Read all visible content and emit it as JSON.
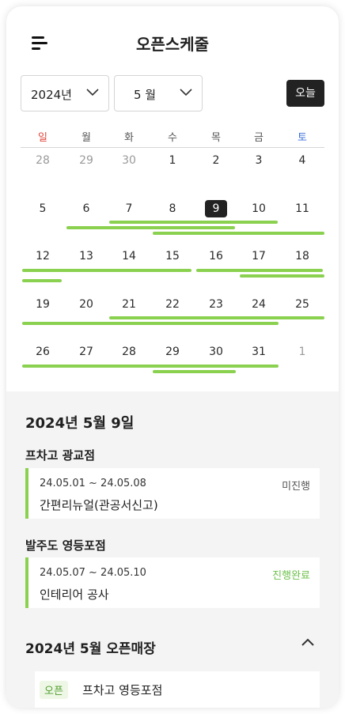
{
  "header": {
    "title": "오픈스케줄",
    "menu_icon": "menu-icon"
  },
  "controls": {
    "year": "2024년",
    "month": "5 월",
    "today_label": "오늘"
  },
  "weekdays": [
    "일",
    "월",
    "화",
    "수",
    "목",
    "금",
    "토"
  ],
  "weekday_colors": {
    "sun": "#e0463c",
    "sat": "#3b6fd8",
    "normal": "#555555"
  },
  "calendar": {
    "weeks": [
      [
        "28",
        "29",
        "30",
        "1",
        "2",
        "3",
        "4"
      ],
      [
        "5",
        "6",
        "7",
        "8",
        "9",
        "10",
        "11"
      ],
      [
        "12",
        "13",
        "14",
        "15",
        "16",
        "17",
        "18"
      ],
      [
        "19",
        "20",
        "21",
        "22",
        "23",
        "24",
        "25"
      ],
      [
        "26",
        "27",
        "28",
        "29",
        "30",
        "31",
        "1"
      ]
    ],
    "selected_day": "9",
    "schedule_bar_color": "#8ad14f"
  },
  "detail": {
    "date_title": "2024년 5월 9일",
    "stores": [
      {
        "name": "프차고 광교점",
        "range": "24.05.01 ~ 24.05.08",
        "task": "간편리뉴얼(관공서신고)",
        "status": "미진행",
        "status_color": "#555555"
      },
      {
        "name": "발주도 영등포점",
        "range": "24.05.07 ~ 24.05.10",
        "task": "인테리어 공사",
        "status": "진행완료",
        "status_color": "#6cc04a"
      }
    ]
  },
  "open_section": {
    "title": "2024년 5월 오픈매장",
    "item": {
      "badge": "오픈",
      "name": "프차고 영등포점"
    }
  }
}
